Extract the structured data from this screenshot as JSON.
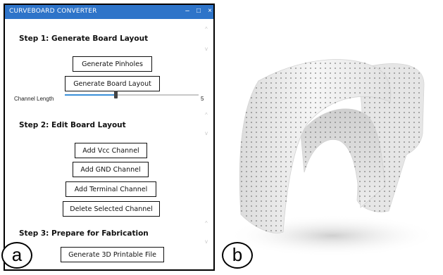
{
  "window": {
    "title": "CURVEBOARD CONVERTER",
    "controls": {
      "minimize": "–",
      "maximize": "□",
      "close": "×"
    }
  },
  "step1": {
    "heading": "Step 1: Generate Board Layout",
    "generate_pinholes": "Generate Pinholes",
    "generate_board_layout": "Generate Board Layout"
  },
  "channel_length": {
    "label": "Channel Length",
    "max_label": "5",
    "level_fraction": 0.38
  },
  "step2": {
    "heading": "Step 2: Edit Board Layout",
    "add_vcc": "Add Vcc Channel",
    "add_gnd": "Add GND Channel",
    "add_terminal": "Add Terminal Channel",
    "delete_selected": "Delete Selected Channel"
  },
  "step3": {
    "heading": "Step 3: Prepare for Fabrication",
    "generate_3d": "Generate 3D Printable File"
  },
  "labels": {
    "a": "a",
    "b": "b"
  },
  "colors": {
    "titlebar": "#2e74c9",
    "slider_fill": "#3a8fd8",
    "render_surface": "#f2f2f2",
    "pinhole": "#7a7a7a"
  },
  "icons": [
    "minimize-icon",
    "maximize-icon",
    "close-icon",
    "scroll-up-icon",
    "scroll-down-icon"
  ]
}
